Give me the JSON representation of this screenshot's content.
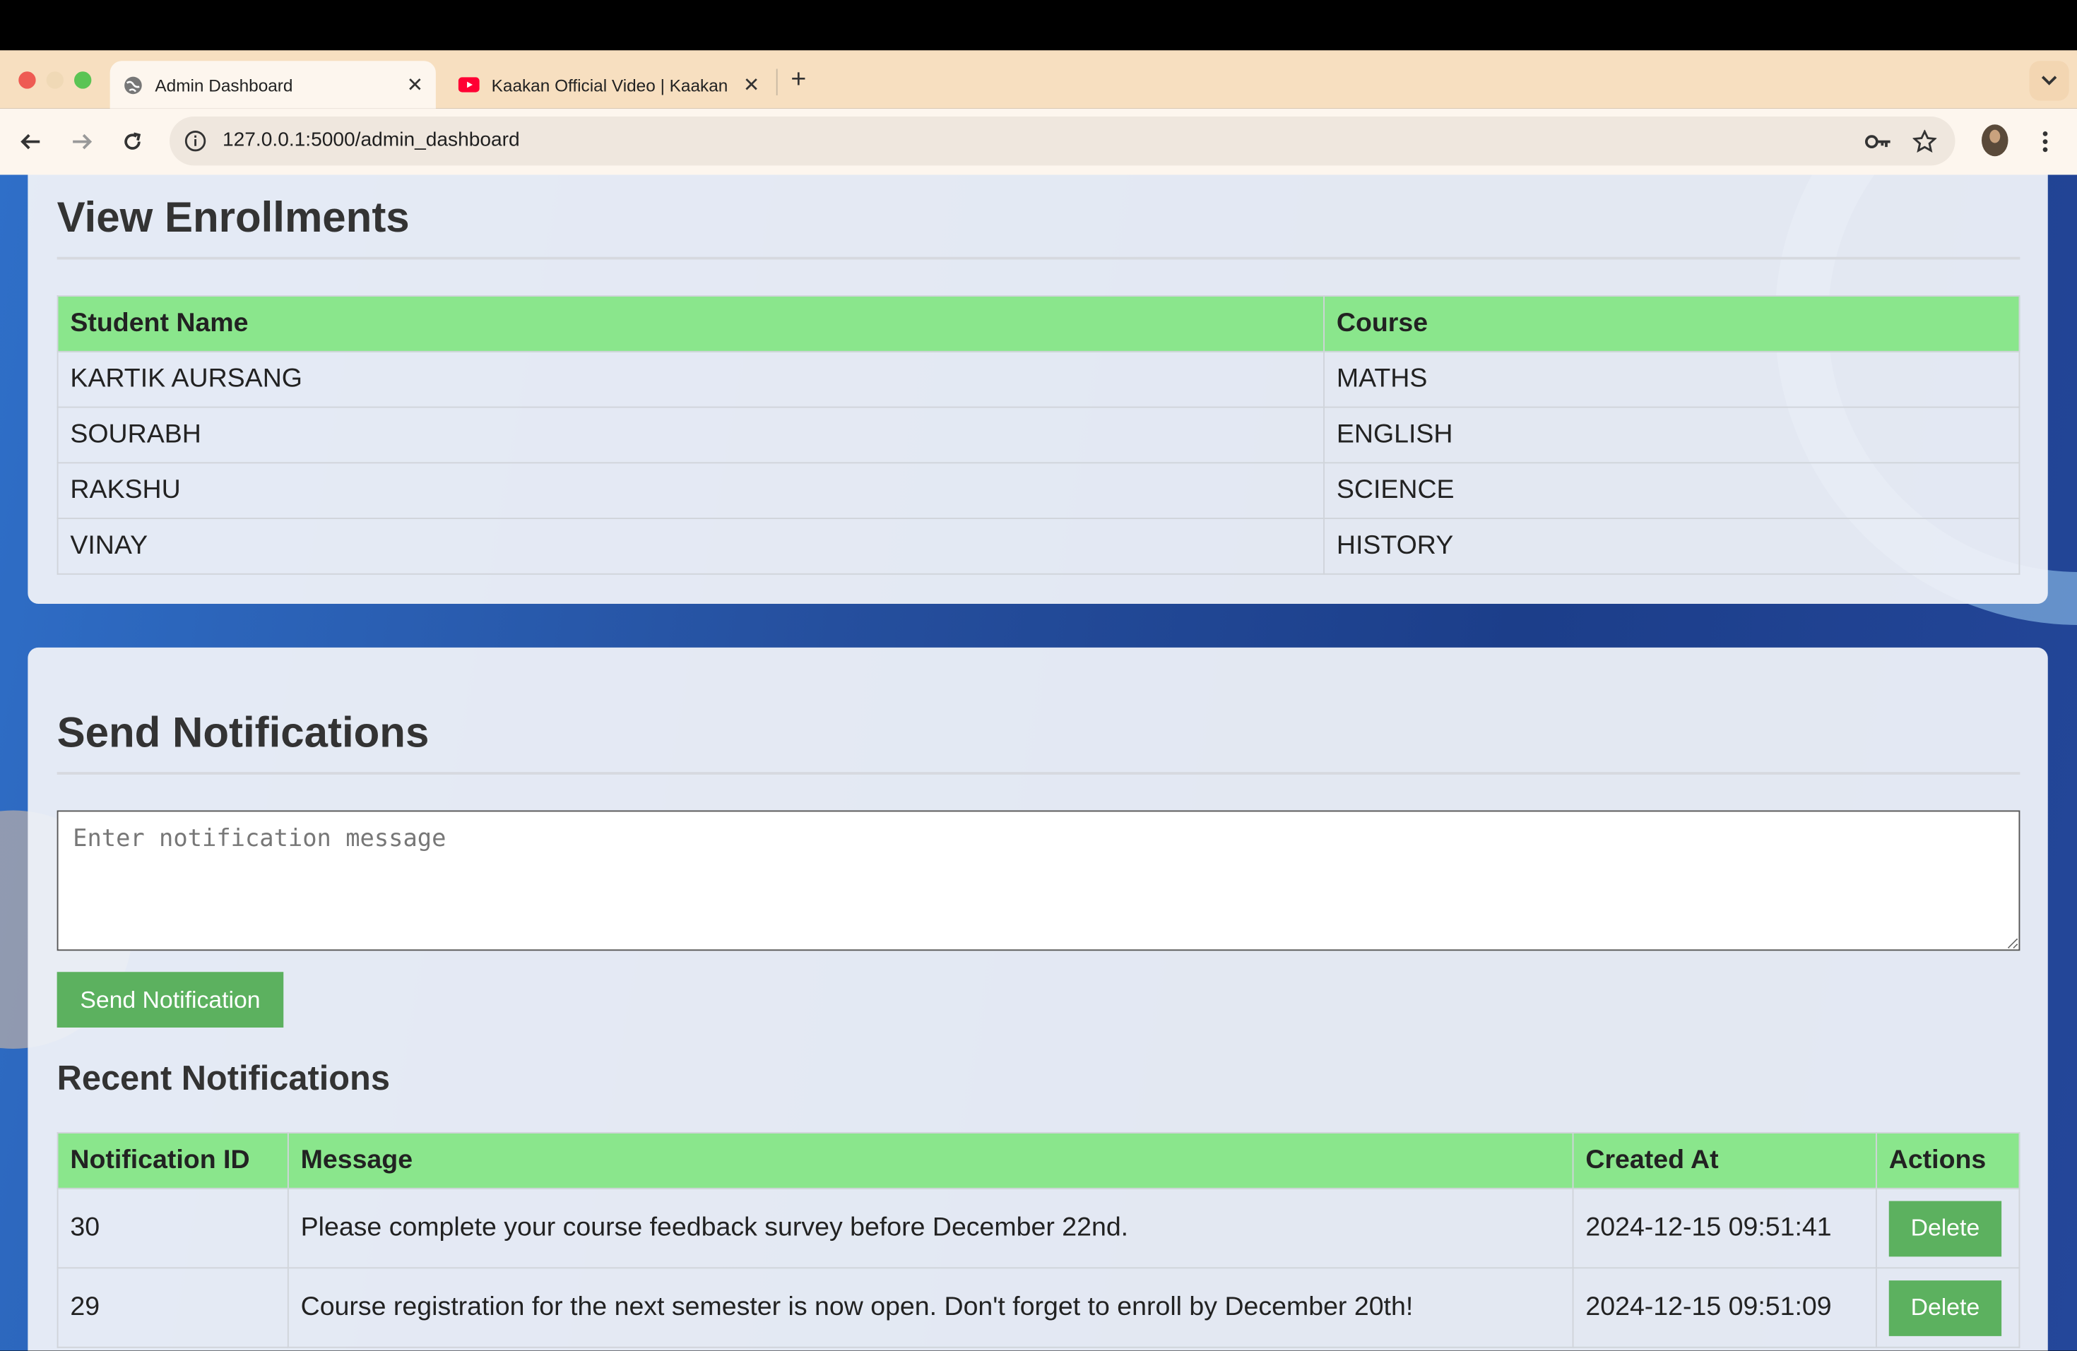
{
  "browser": {
    "tabs": [
      {
        "title": "Admin Dashboard",
        "active": true,
        "icon": "globe-icon"
      },
      {
        "title": "Kaakan Official Video | Kaakan",
        "active": false,
        "icon": "youtube-icon"
      }
    ],
    "url": "127.0.0.1:5000/admin_dashboard"
  },
  "enrollments": {
    "heading": "View Enrollments",
    "columns": [
      "Student Name",
      "Course"
    ],
    "rows": [
      [
        "KARTIK AURSANG",
        "MATHS"
      ],
      [
        "SOURABH",
        "ENGLISH"
      ],
      [
        "RAKSHU",
        "SCIENCE"
      ],
      [
        "VINAY",
        "HISTORY"
      ]
    ]
  },
  "notifications": {
    "heading": "Send Notifications",
    "input_placeholder": "Enter notification message",
    "send_label": "Send Notification",
    "recent_heading": "Recent Notifications",
    "columns": [
      "Notification ID",
      "Message",
      "Created At",
      "Actions"
    ],
    "rows": [
      {
        "id": "30",
        "message": "Please complete your course feedback survey before December 22nd.",
        "created_at": "2024-12-15 09:51:41",
        "action": "Delete"
      },
      {
        "id": "29",
        "message": "Course registration for the next semester is now open. Don't forget to enroll by December 20th!",
        "created_at": "2024-12-15 09:51:09",
        "action": "Delete"
      }
    ]
  },
  "colors": {
    "table_header": "#8ae68c",
    "button": "#5cb15f",
    "tab_strip": "#f7dfc0"
  }
}
